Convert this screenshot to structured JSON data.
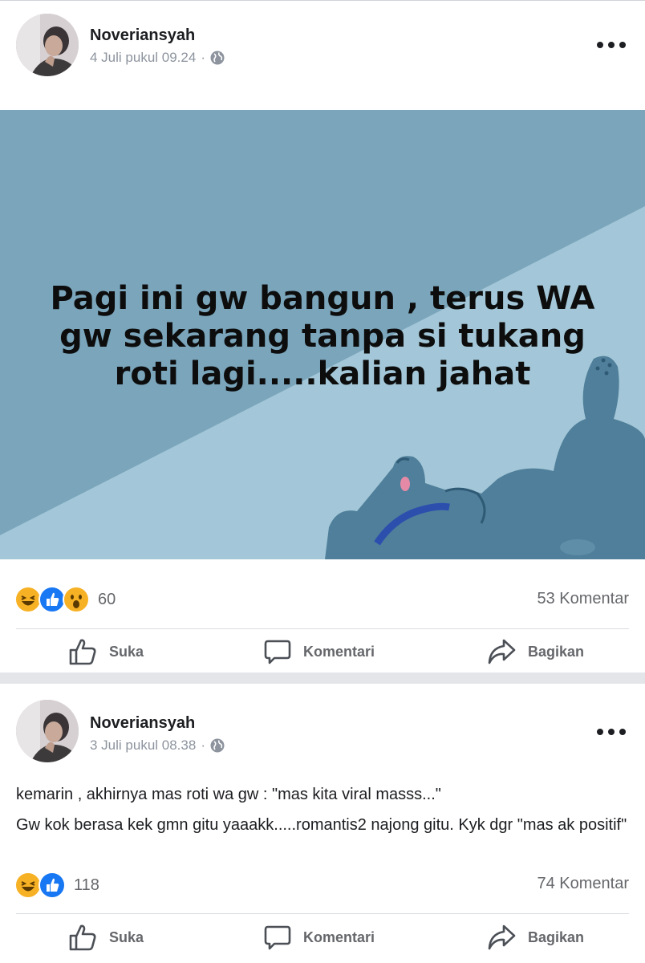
{
  "posts": [
    {
      "author": "Noveriansyah",
      "timestamp": "4 Juli pukul 09.24",
      "separator": "·",
      "privacy_icon": "globe-icon",
      "background_post_text": "Pagi ini gw bangun , terus WA gw sekarang tanpa si tukang roti lagi.....kalian jahat",
      "reactions": [
        "haha",
        "like",
        "wow"
      ],
      "reaction_count": "60",
      "comment_count": "53 Komentar",
      "actions": {
        "like": "Suka",
        "comment": "Komentari",
        "share": "Bagikan"
      }
    },
    {
      "author": "Noveriansyah",
      "timestamp": "3 Juli pukul 08.38",
      "separator": "·",
      "privacy_icon": "globe-icon",
      "paragraphs": [
        "kemarin , akhirnya mas roti wa gw : \"mas kita viral masss...\"",
        "Gw kok berasa kek gmn gitu yaaakk.....romantis2 najong gitu. Kyk dgr \"mas ak positif\""
      ],
      "reactions": [
        "haha",
        "like"
      ],
      "reaction_count": "118",
      "comment_count": "74 Komentar",
      "actions": {
        "like": "Suka",
        "comment": "Komentari",
        "share": "Bagikan"
      }
    }
  ],
  "colors": {
    "banner_dark": "#7aa5bb",
    "banner_light": "#a3c7d8",
    "figure": "#4f7f9a",
    "collar": "#2c4fae",
    "reaction_yellow": "#f7b125",
    "reaction_blue": "#1877f2",
    "meta_gray": "#8d949e"
  }
}
